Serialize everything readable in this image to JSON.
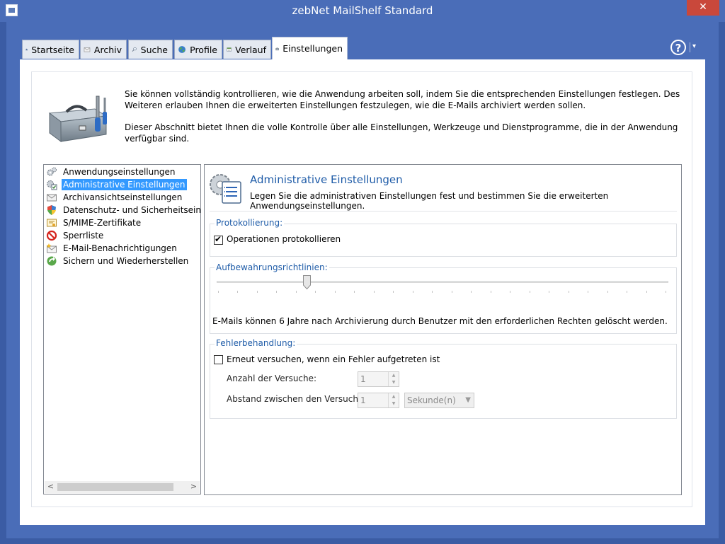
{
  "window": {
    "title": "zebNet MailShelf Standard",
    "close_label": "✕"
  },
  "tabs": [
    {
      "label": "Startseite",
      "icon": "home-icon"
    },
    {
      "label": "Archiv",
      "icon": "envelope-icon"
    },
    {
      "label": "Suche",
      "icon": "magnifier-icon"
    },
    {
      "label": "Profile",
      "icon": "globe-icon"
    },
    {
      "label": "Verlauf",
      "icon": "calendar-icon"
    },
    {
      "label": "Einstellungen",
      "icon": "toolbox-icon",
      "active": true
    }
  ],
  "help": {
    "label": "?",
    "dropdown": "▾"
  },
  "header": {
    "text1": "Sie können vollständig kontrollieren, wie die Anwendung arbeiten soll, indem Sie die entsprechenden Einstellungen festlegen. Des Weiteren erlauben Ihnen die erweiterten Einstellungen festzulegen, wie die E-Mails archiviert werden sollen.",
    "text2": "Dieser Abschnitt bietet Ihnen die volle Kontrolle über alle Einstellungen, Werkzeuge und Dienstprogramme, die in der Anwendung verfügbar sind."
  },
  "nav": {
    "items": [
      {
        "label": "Anwendungseinstellungen",
        "icon": "gears-icon"
      },
      {
        "label": "Administrative Einstellungen",
        "icon": "admin-gear-icon",
        "selected": true
      },
      {
        "label": "Archivansichtseinstellungen",
        "icon": "envelope-icon"
      },
      {
        "label": "Datenschutz- und Sicherheitseinstellu",
        "icon": "shield-icon"
      },
      {
        "label": "S/MIME-Zertifikate",
        "icon": "certificate-icon"
      },
      {
        "label": "Sperrliste",
        "icon": "block-icon"
      },
      {
        "label": "E-Mail-Benachrichtigungen",
        "icon": "mail-notification-icon"
      },
      {
        "label": "Sichern und Wiederherstellen",
        "icon": "backup-icon"
      }
    ],
    "scroll_left": "<",
    "scroll_right": ">"
  },
  "section": {
    "title": "Administrative Einstellungen",
    "description": "Legen Sie die administrativen Einstellungen fest und bestimmen Sie die erweiterten Anwendungseinstellungen."
  },
  "logging": {
    "group_label": "Protokollierung:",
    "checkbox_label": "Operationen protokollieren",
    "checked": true
  },
  "retention": {
    "group_label": "Aufbewahrungsrichtlinien:",
    "slider_value_fraction": 0.2,
    "info": "E-Mails können 6 Jahre nach Archivierung durch Benutzer mit den erforderlichen Rechten gelöscht werden."
  },
  "errors": {
    "group_label": "Fehlerbehandlung:",
    "retry_label": "Erneut versuchen, wenn ein Fehler aufgetreten ist",
    "retry_checked": false,
    "attempts_label": "Anzahl der Versuche:",
    "attempts_value": "1",
    "interval_label": "Abstand zwischen den Versuchen:",
    "interval_value": "1",
    "unit_value": "Sekunde(n)"
  },
  "colors": {
    "accent": "#4a6db8",
    "selection": "#3399ff",
    "section_title": "#1f5ca8"
  }
}
